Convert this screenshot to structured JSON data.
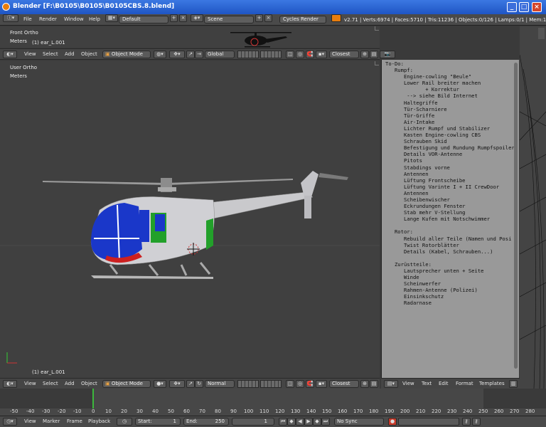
{
  "window": {
    "title": "Blender [F:\\B0105\\B0105\\B0105CBS.8.blend]"
  },
  "infobar": {
    "menus": [
      "File",
      "Render",
      "Window",
      "Help"
    ],
    "layout": "Default",
    "scene": "Scene",
    "engine": "Cycles Render",
    "stats": "v2.71 | Verts:6974 | Faces:5710 | Tris:11236 | Objects:0/126 | Lamps:0/1 | Mem:14.11M (0"
  },
  "front_view": {
    "label1": "Front Ortho",
    "label2": "Meters",
    "object": "(1) ear_L.001",
    "menus": [
      "View",
      "Select",
      "Add",
      "Object"
    ],
    "mode": "Object Mode",
    "orientation": "Global",
    "snap": "Closest"
  },
  "user_view": {
    "label1": "User Ortho",
    "label2": "Meters",
    "object": "(1) ear_L.001",
    "menus": [
      "View",
      "Select",
      "Add",
      "Object"
    ],
    "mode": "Object Mode",
    "pivot": "Normal",
    "snap": "Closest"
  },
  "text_editor": {
    "content": "To-Do:\n   Rumpf:\n      Engine-cowling \"Beule\"\n      Lower Rail breiter machen\n             + Korrektur\n       --> siehe Bild Internet\n      Haltegriffe\n      Tür-Scharniere\n      Tür-Griffe\n      Air-Intake\n      Lichter Rumpf und Stabilizer\n      Kasten Engine-cowling CBS\n      Schrauben Skid\n      Befestigung und Rundung Rumpfspoiler\n      Details VOR-Antenne\n      Pitots\n      Stabdings vorne\n      Antennen\n      Lüftung Frontscheibe\n      Lüftung Varinte I + II CrewDoor\n      Antennen\n      Scheibenwischer\n      Eckrundungen Fenster\n      Stab mehr V-Stellung\n      Lange Kufen mit Notschwimmer\n\n   Rotor:\n      Rebuild aller Teile (Namen und Posi\n      Twist Rotorblätter\n      Details (Kabel, Schrauben...)\n\n   Zurüstteile:\n      Lautsprecher unten + Seite\n      Winde\n      Scheinwerfer\n      Rahmen-Antenne (Polizei)\n      Einsinkschutz\n      Radarnase",
    "menus": [
      "View",
      "Text",
      "Edit",
      "Format",
      "Templates"
    ]
  },
  "timeline": {
    "ticks": [
      "-50",
      "-40",
      "-30",
      "-20",
      "-10",
      "0",
      "10",
      "20",
      "30",
      "40",
      "50",
      "60",
      "70",
      "80",
      "90",
      "100",
      "110",
      "120",
      "130",
      "140",
      "150",
      "160",
      "170",
      "180",
      "190",
      "200",
      "210",
      "220",
      "230",
      "240",
      "250",
      "260",
      "270",
      "280"
    ],
    "menus": [
      "View",
      "Marker",
      "Frame",
      "Playback"
    ],
    "start_label": "Start:",
    "start": "1",
    "end_label": "End:",
    "end": "250",
    "current": "1",
    "sync": "No Sync"
  },
  "colors": {
    "accent": "#e87d0d",
    "titlebar": "#1f55c4",
    "viewport": "#404040"
  }
}
